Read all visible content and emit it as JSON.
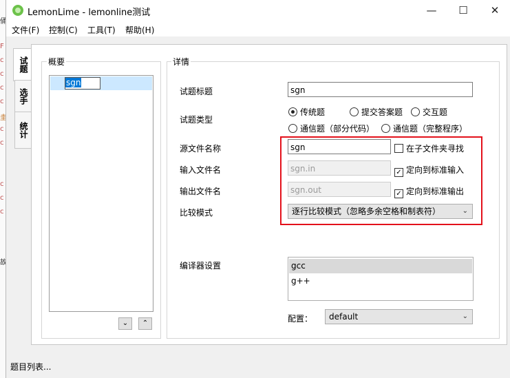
{
  "window": {
    "title": "LemonLime - lemonline测试",
    "minimize": "—",
    "maximize": "☐",
    "close": "✕"
  },
  "menu": [
    "文件(F)",
    "控制(C)",
    "工具(T)",
    "帮助(H)"
  ],
  "side_tabs": [
    "试题",
    "选手",
    "统计"
  ],
  "overview": {
    "label": "概要",
    "tree_item": "sgn",
    "down_button": "⌄",
    "up_button": "⌃"
  },
  "details": {
    "label": "详情",
    "title_label": "试题标题",
    "title_value": "sgn",
    "type_label": "试题类型",
    "types": [
      "传统题",
      "提交答案题",
      "交互题",
      "通信题（部分代码）",
      "通信题（完整程序）"
    ],
    "selected_type": "传统题",
    "source_label": "源文件名称",
    "source_value": "sgn",
    "subfolder_label": "在子文件夹寻找",
    "subfolder_checked": false,
    "input_label": "输入文件名",
    "input_value": "sgn.in",
    "redirect_input_label": "定向到标准输入",
    "redirect_input_checked": true,
    "output_label": "输出文件名",
    "output_value": "sgn.out",
    "redirect_output_label": "定向到标准输出",
    "redirect_output_checked": true,
    "compare_label": "比较模式",
    "compare_value": "逐行比较模式（忽略多余空格和制表符）",
    "compiler_label": "编译器设置",
    "compilers": [
      "gcc",
      "g++"
    ],
    "config_label": "配置：",
    "config_value": "default"
  },
  "status": "题目列表...",
  "left_strip_chars": [
    "俑",
    "F",
    "c",
    "c",
    "c",
    "c",
    "圭",
    "c",
    "c",
    "c",
    "c",
    "c",
    "故"
  ]
}
